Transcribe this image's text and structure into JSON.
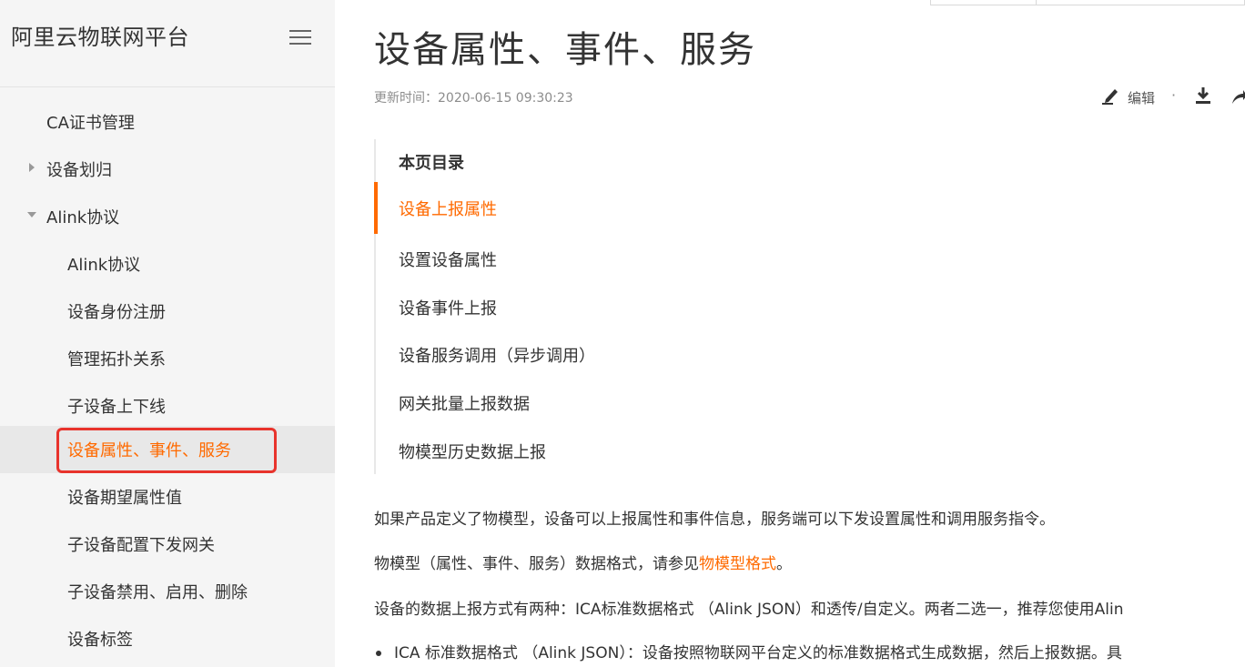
{
  "sidebar": {
    "title": "阿里云物联网平台",
    "menu_icon": "hamburger-menu-icon",
    "items": [
      {
        "label": "CA证书管理"
      },
      {
        "label": "设备划归",
        "caret": "right"
      },
      {
        "label": "Alink协议",
        "caret": "down"
      },
      {
        "label": "Alink协议"
      },
      {
        "label": "设备身份注册"
      },
      {
        "label": "管理拓扑关系"
      },
      {
        "label": "子设备上下线"
      },
      {
        "label": "设备属性、事件、服务",
        "active": true
      },
      {
        "label": "设备期望属性值"
      },
      {
        "label": "子设备配置下发网关"
      },
      {
        "label": "子设备禁用、启用、删除"
      },
      {
        "label": "设备标签"
      }
    ]
  },
  "article": {
    "title": "设备属性、事件、服务",
    "update_time": "更新时间：2020-06-15 09:30:23",
    "tools": {
      "edit_label": "编辑",
      "separator": "·",
      "edit_icon": "edit-pen-icon",
      "download_icon": "download-icon",
      "share_icon": "share-icon"
    },
    "toc": {
      "title": "本页目录",
      "items": [
        "设备上报属性",
        "设置设备属性",
        "设备事件上报",
        "设备服务调用（异步调用）",
        "网关批量上报数据",
        "物模型历史数据上报"
      ]
    },
    "paragraphs": {
      "p1": "如果产品定义了物模型，设备可以上报属性和事件信息，服务端可以下发设置属性和调用服务指令。",
      "p2_prefix": "物模型（属性、事件、服务）数据格式，请参见",
      "p2_link": "物模型格式",
      "p2_suffix": "。",
      "p3": "设备的数据上报方式有两种：ICA标准数据格式 （Alink JSON）和透传/自定义。两者二选一，推荐您使用Alin",
      "bullet1": "ICA 标准数据格式 （Alink JSON）：设备按照物联网平台定义的标准数据格式生成数据，然后上报数据。具"
    }
  },
  "colors": {
    "accent": "#ff6a00",
    "highlight_box": "#e8332c",
    "sidebar_bg": "#f5f5f5",
    "text": "#333333",
    "muted": "#8c8c8c"
  }
}
